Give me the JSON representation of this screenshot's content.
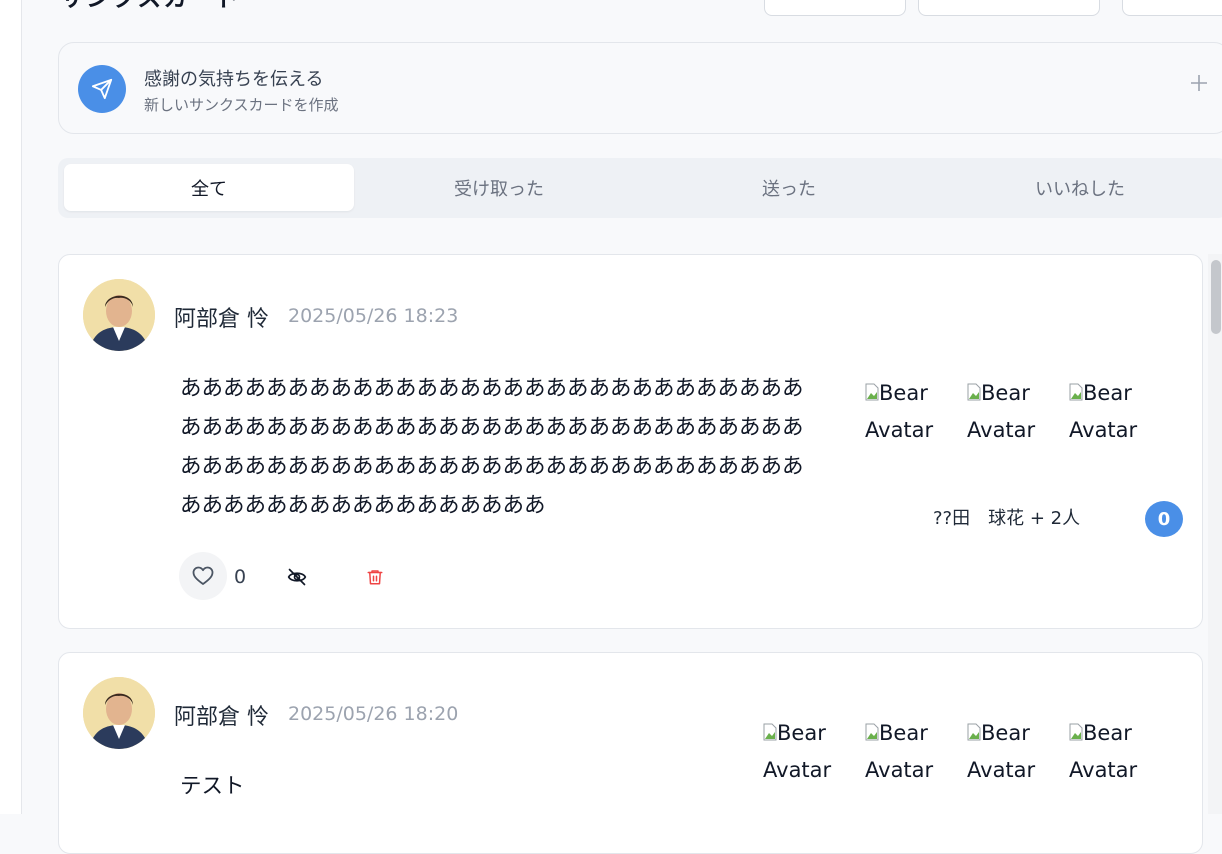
{
  "header": {
    "title_fragment": "サンクスカード"
  },
  "compose": {
    "title": "感謝の気持ちを伝える",
    "subtitle": "新しいサンクスカードを作成",
    "icon": "send-icon",
    "add_icon": "plus-icon"
  },
  "tabs": [
    {
      "label": "全て",
      "active": true
    },
    {
      "label": "受け取った",
      "active": false
    },
    {
      "label": "送った",
      "active": false
    },
    {
      "label": "いいねした",
      "active": false
    }
  ],
  "cards": [
    {
      "sender": "阿部倉 怜",
      "date": "2025/05/26 18:23",
      "message": "ああああああああああああああああああああああああああああああああああああああああああああああああああああああああああああああああああああああああああああああああああああああああああああああああああああああああ",
      "recipient_avatars": [
        "Bear Avatar",
        "Bear Avatar",
        "Bear Avatar"
      ],
      "recipients_label": "??田　球花 + 2人",
      "comment_count": "0",
      "like_count": "0"
    },
    {
      "sender": "阿部倉 怜",
      "date": "2025/05/26 18:20",
      "message": "テスト",
      "recipient_avatars": [
        "Bear Avatar",
        "Bear Avatar",
        "Bear Avatar",
        "Bear Avatar"
      ]
    }
  ],
  "colors": {
    "accent": "#4a8fe7",
    "delete": "#ef4444",
    "muted_text": "#9ca3af"
  }
}
